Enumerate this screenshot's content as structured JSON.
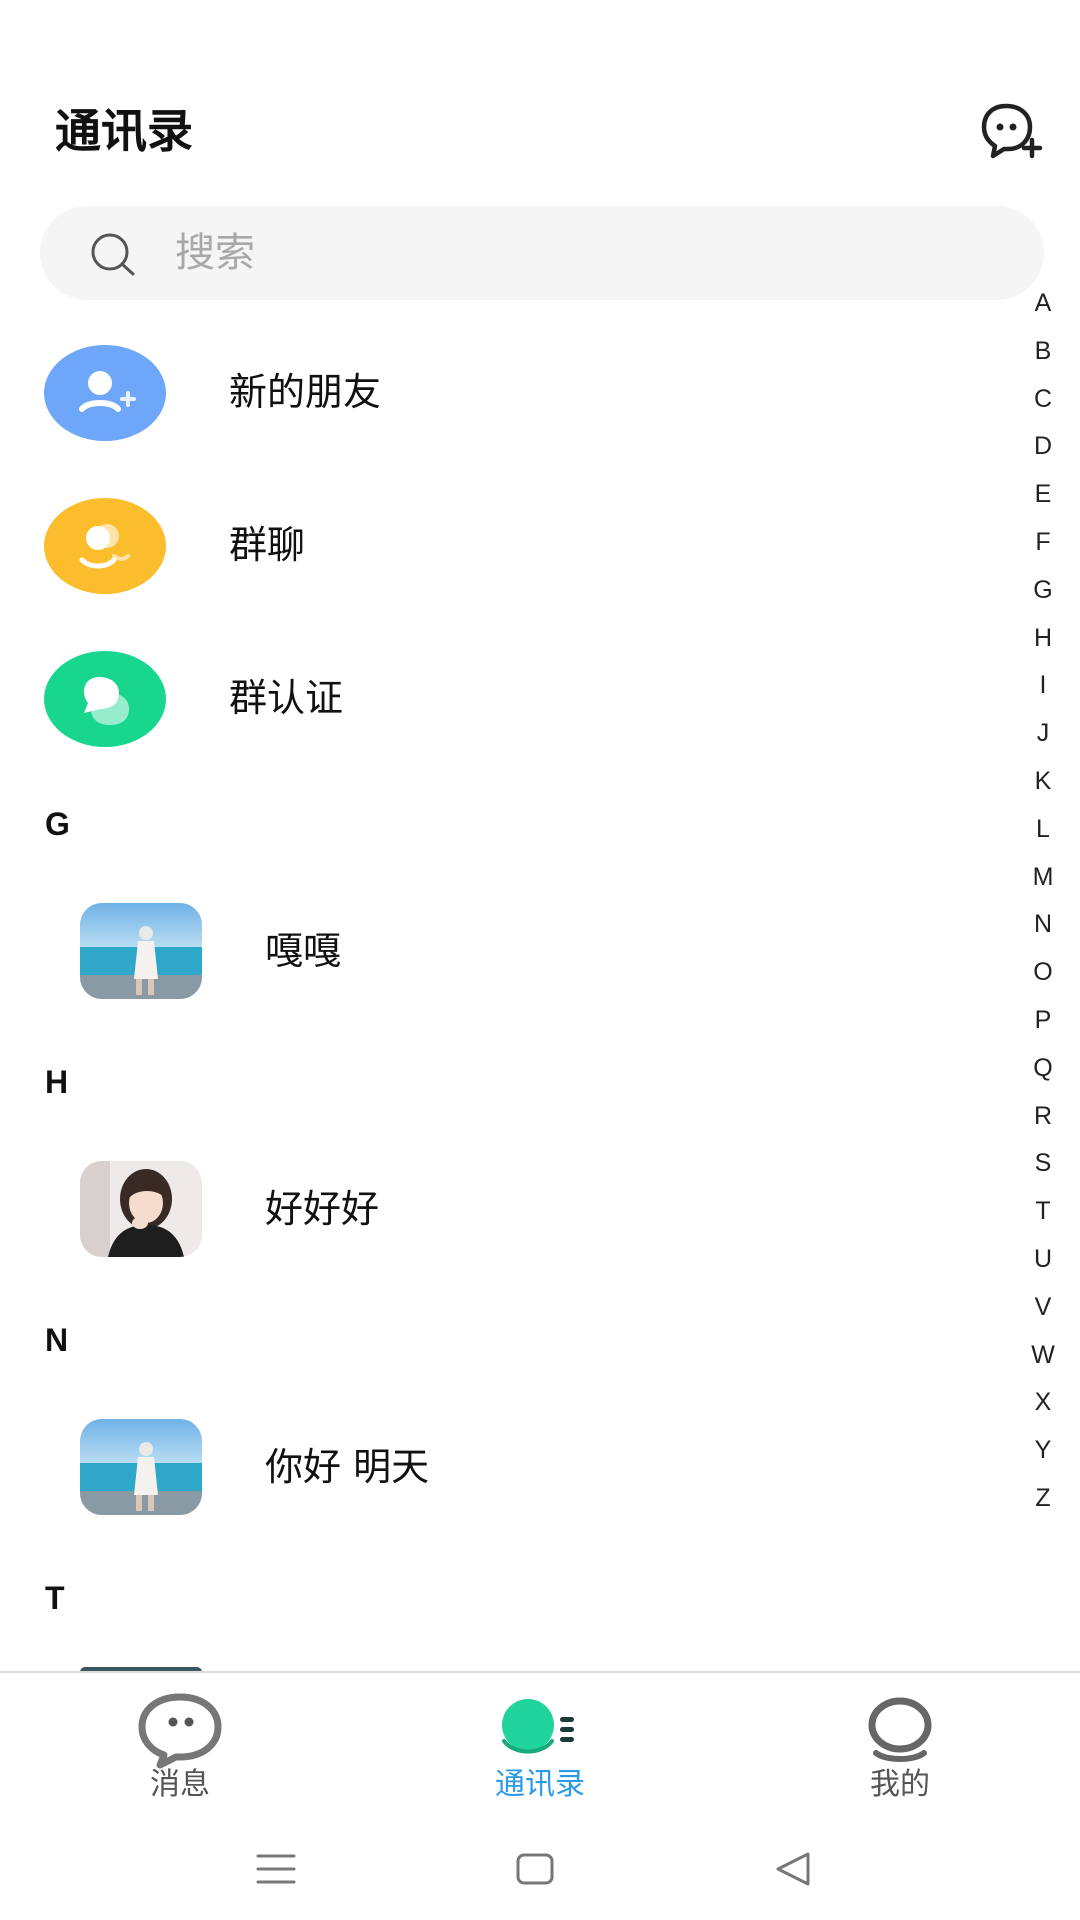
{
  "header": {
    "title": "通讯录",
    "add_icon": "add-chat-icon"
  },
  "search": {
    "placeholder": "搜索",
    "icon": "search-icon"
  },
  "special_items": [
    {
      "label": "新的朋友",
      "icon": "add-friend-icon",
      "color": "#6ea6f9"
    },
    {
      "label": "群聊",
      "icon": "group-chat-icon",
      "color": "#fbbd2c"
    },
    {
      "label": "群认证",
      "icon": "group-verify-icon",
      "color": "#18d68e"
    }
  ],
  "sections": [
    {
      "letter": "G",
      "contacts": [
        {
          "name": "嘎嘎",
          "avatar": "beach-photo"
        }
      ]
    },
    {
      "letter": "H",
      "contacts": [
        {
          "name": "好好好",
          "avatar": "portrait-photo"
        }
      ]
    },
    {
      "letter": "N",
      "contacts": [
        {
          "name": "你好 明天",
          "avatar": "beach-photo"
        }
      ]
    },
    {
      "letter": "T",
      "contacts": []
    }
  ],
  "index_letters": [
    "A",
    "B",
    "C",
    "D",
    "E",
    "F",
    "G",
    "H",
    "I",
    "J",
    "K",
    "L",
    "M",
    "N",
    "O",
    "P",
    "Q",
    "R",
    "S",
    "T",
    "U",
    "V",
    "W",
    "X",
    "Y",
    "Z"
  ],
  "tabs": [
    {
      "label": "消息",
      "icon": "message-icon",
      "active": false
    },
    {
      "label": "通讯录",
      "icon": "contacts-icon",
      "active": true
    },
    {
      "label": "我的",
      "icon": "profile-icon",
      "active": false
    }
  ],
  "colors": {
    "accent": "#2b9be8",
    "tab_active_icon": "#1fd39a",
    "search_bg": "#f5f5f5"
  },
  "system_nav": [
    "menu-icon",
    "home-icon",
    "back-icon"
  ]
}
